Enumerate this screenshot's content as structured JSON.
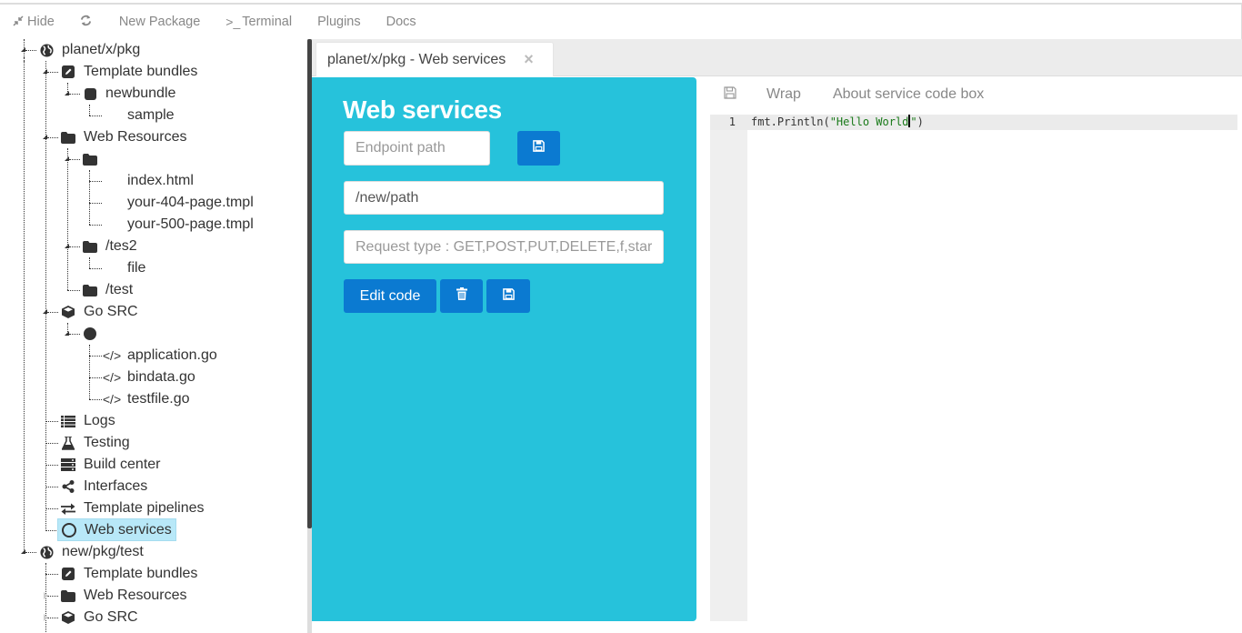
{
  "toolbar": {
    "items": [
      {
        "label": "Hide",
        "icon": "compress-icon"
      },
      {
        "label": "",
        "icon": "refresh-icon"
      },
      {
        "label": "New Package",
        "icon": ""
      },
      {
        "label": "Terminal",
        "icon": "terminal-icon",
        "prefix": ">_"
      },
      {
        "label": "Plugins",
        "icon": ""
      },
      {
        "label": "Docs",
        "icon": ""
      }
    ]
  },
  "tree": {
    "pkg1": {
      "label": "planet/x/pkg",
      "template_bundles": "Template bundles",
      "newbundle": "newbundle",
      "sample": "sample",
      "web_resources": "Web Resources",
      "root_folder": "",
      "index": "index.html",
      "p404": "your-404-page.tmpl",
      "p500": "your-500-page.tmpl",
      "tes2": "/tes2",
      "file": "file",
      "test": "/test",
      "go_src": "Go SRC",
      "go_root": "",
      "application": "application.go",
      "bindata": "bindata.go",
      "testfile": "testfile.go",
      "logs": "Logs",
      "testing": "Testing",
      "build_center": "Build center",
      "interfaces": "Interfaces",
      "template_pipelines": "Template pipelines",
      "web_services": "Web services"
    },
    "pkg2": {
      "label": "new/pkg/test",
      "template_bundles": "Template bundles",
      "web_resources": "Web Resources",
      "go_src": "Go SRC"
    },
    "selected": "Web services"
  },
  "tab": {
    "title": "planet/x/pkg - Web services",
    "close": "×"
  },
  "panel": {
    "title": "Web services",
    "endpoint_placeholder": "Endpoint path",
    "path_value": "/new/path",
    "request_type_placeholder": "Request type : GET,POST,PUT,DELETE,f,star..",
    "edit_code_label": "Edit code",
    "accent": "#26c2db",
    "button_color": "#0b7ad1"
  },
  "editor": {
    "wrap_label": "Wrap",
    "about_label": "About service code box",
    "line_number": "1",
    "code_prefix": "fmt.Println(",
    "code_string_before_cursor": "\"Hello World",
    "code_string_after_cursor": "\"",
    "code_suffix": ")"
  }
}
